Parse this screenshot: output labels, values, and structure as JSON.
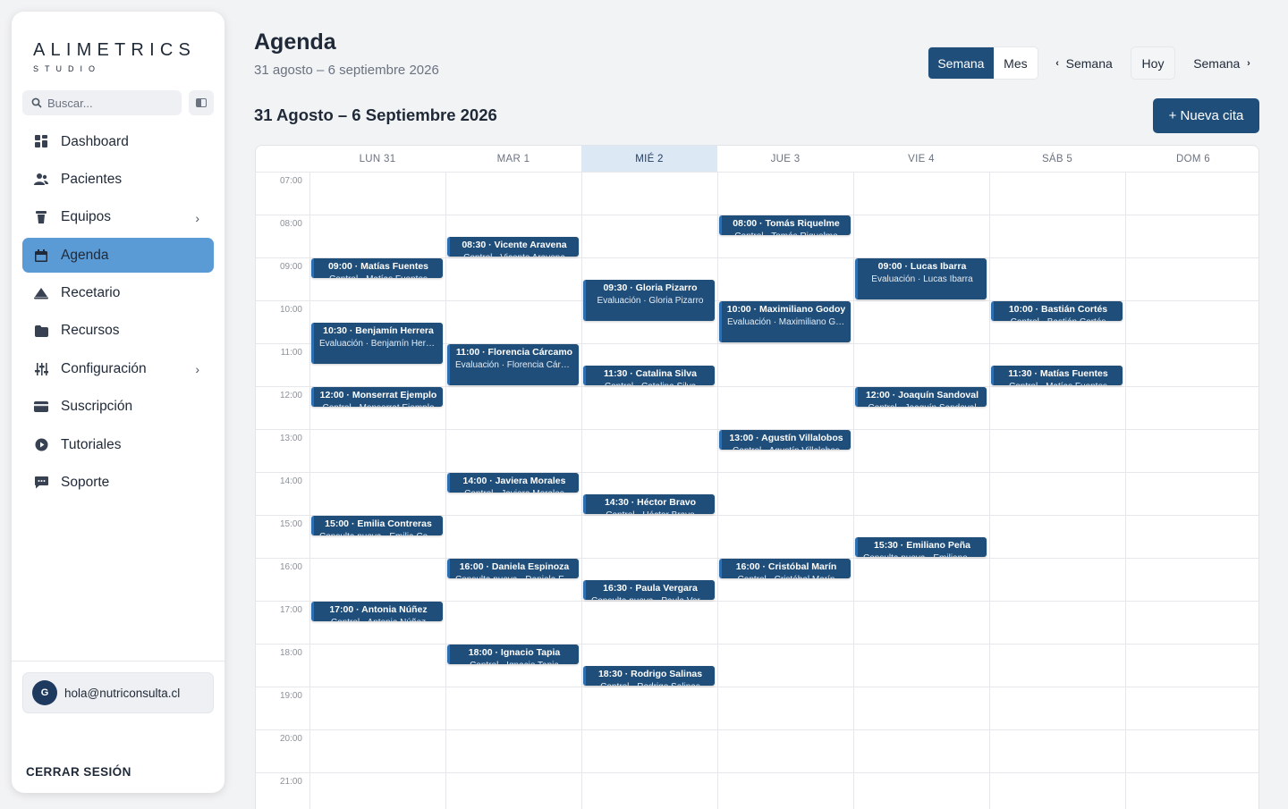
{
  "brand": {
    "name": "ALIMETRICS",
    "sub": "STUDIO"
  },
  "search": {
    "placeholder": "Buscar..."
  },
  "sidebar": {
    "items": [
      {
        "id": "dashboard",
        "label": "Dashboard",
        "icon": "dashboard-icon",
        "chevron": false,
        "active": false
      },
      {
        "id": "pacientes",
        "label": "Pacientes",
        "icon": "users-icon",
        "chevron": false,
        "active": false
      },
      {
        "id": "equipos",
        "label": "Equipos",
        "icon": "flask-icon",
        "chevron": true,
        "active": false
      },
      {
        "id": "agenda",
        "label": "Agenda",
        "icon": "calendar-icon",
        "chevron": false,
        "active": true
      },
      {
        "id": "recetario",
        "label": "Recetario",
        "icon": "recipe-icon",
        "chevron": false,
        "active": false
      },
      {
        "id": "recursos",
        "label": "Recursos",
        "icon": "folder-icon",
        "chevron": false,
        "active": false
      },
      {
        "id": "configuracion",
        "label": "Configuración",
        "icon": "sliders-icon",
        "chevron": true,
        "active": false
      },
      {
        "id": "suscripcion",
        "label": "Suscripción",
        "icon": "credit-card-icon",
        "chevron": false,
        "active": false
      },
      {
        "id": "tutoriales",
        "label": "Tutoriales",
        "icon": "play-icon",
        "chevron": false,
        "active": false
      },
      {
        "id": "soporte",
        "label": "Soporte",
        "icon": "chat-icon",
        "chevron": false,
        "active": false
      }
    ]
  },
  "user": {
    "initial": "G",
    "email": "hola@nutriconsulta.cl"
  },
  "logout_label": "CERRAR SESIÓN",
  "header": {
    "title": "Agenda",
    "subtitle": "31 agosto – 6 septiembre 2026",
    "view_week": "Semana",
    "view_month": "Mes",
    "prev_label": "Semana",
    "today_label": "Hoy",
    "next_label": "Semana"
  },
  "range_title": "31 Agosto – 6 Septiembre 2026",
  "new_button": "+ Nueva cita",
  "days": [
    "LUN 31",
    "MAR 1",
    "MIÉ 2",
    "JUE 3",
    "VIE 4",
    "SÁB 5",
    "DOM 6"
  ],
  "today_index": 2,
  "hours": [
    "07:00",
    "08:00",
    "09:00",
    "10:00",
    "11:00",
    "12:00",
    "13:00",
    "14:00",
    "15:00",
    "16:00",
    "17:00",
    "18:00",
    "19:00",
    "20:00",
    "21:00"
  ],
  "events": [
    {
      "day": 0,
      "start": "09:00",
      "hours": 0.5,
      "title": "09:00 · Matías Fuentes",
      "sub": "Control · Matías Fuentes"
    },
    {
      "day": 0,
      "start": "10:30",
      "hours": 1,
      "title": "10:30 · Benjamín Herrera",
      "sub": "Evaluación · Benjamín Herrera"
    },
    {
      "day": 0,
      "start": "12:00",
      "hours": 0.5,
      "title": "12:00 · Monserrat Ejemplo",
      "sub": "Control · Monserrat Ejemplo"
    },
    {
      "day": 0,
      "start": "15:00",
      "hours": 0.5,
      "title": "15:00 · Emilia Contreras",
      "sub": "Consulta nueva · Emilia Contreras"
    },
    {
      "day": 0,
      "start": "17:00",
      "hours": 0.5,
      "title": "17:00 · Antonia Núñez",
      "sub": "Control · Antonia Núñez"
    },
    {
      "day": 1,
      "start": "08:30",
      "hours": 0.5,
      "title": "08:30 · Vicente Aravena",
      "sub": "Control · Vicente Aravena"
    },
    {
      "day": 1,
      "start": "11:00",
      "hours": 1,
      "title": "11:00 · Florencia Cárcamo",
      "sub": "Evaluación · Florencia Cárcamo"
    },
    {
      "day": 1,
      "start": "14:00",
      "hours": 0.5,
      "title": "14:00 · Javiera Morales",
      "sub": "Control · Javiera Morales"
    },
    {
      "day": 1,
      "start": "16:00",
      "hours": 0.5,
      "title": "16:00 · Daniela Espinoza",
      "sub": "Consulta nueva · Daniela Espinoza"
    },
    {
      "day": 1,
      "start": "18:00",
      "hours": 0.5,
      "title": "18:00 · Ignacio Tapia",
      "sub": "Control · Ignacio Tapia"
    },
    {
      "day": 2,
      "start": "09:30",
      "hours": 1,
      "title": "09:30 · Gloria Pizarro",
      "sub": "Evaluación · Gloria Pizarro"
    },
    {
      "day": 2,
      "start": "11:30",
      "hours": 0.5,
      "title": "11:30 · Catalina Silva",
      "sub": "Control · Catalina Silva"
    },
    {
      "day": 2,
      "start": "14:30",
      "hours": 0.5,
      "title": "14:30 · Héctor Bravo",
      "sub": "Control · Héctor Bravo"
    },
    {
      "day": 2,
      "start": "16:30",
      "hours": 0.5,
      "title": "16:30 · Paula Vergara",
      "sub": "Consulta nueva · Paula Vergara"
    },
    {
      "day": 2,
      "start": "18:30",
      "hours": 0.5,
      "title": "18:30 · Rodrigo Salinas",
      "sub": "Control · Rodrigo Salinas"
    },
    {
      "day": 3,
      "start": "08:00",
      "hours": 0.5,
      "title": "08:00 · Tomás Riquelme",
      "sub": "Control · Tomás Riquelme"
    },
    {
      "day": 3,
      "start": "10:00",
      "hours": 1,
      "title": "10:00 · Maximiliano Godoy",
      "sub": "Evaluación · Maximiliano Godoy"
    },
    {
      "day": 3,
      "start": "13:00",
      "hours": 0.5,
      "title": "13:00 · Agustín Villalobos",
      "sub": "Control · Agustín Villalobos"
    },
    {
      "day": 3,
      "start": "16:00",
      "hours": 0.5,
      "title": "16:00 · Cristóbal Marín",
      "sub": "Control · Cristóbal Marín"
    },
    {
      "day": 4,
      "start": "09:00",
      "hours": 1,
      "title": "09:00 · Lucas Ibarra",
      "sub": "Evaluación · Lucas Ibarra"
    },
    {
      "day": 4,
      "start": "12:00",
      "hours": 0.5,
      "title": "12:00 · Joaquín Sandoval",
      "sub": "Control · Joaquín Sandoval"
    },
    {
      "day": 4,
      "start": "15:30",
      "hours": 0.5,
      "title": "15:30 · Emiliano Peña",
      "sub": "Consulta nueva · Emiliano Peña"
    },
    {
      "day": 5,
      "start": "10:00",
      "hours": 0.5,
      "title": "10:00 · Bastián Cortés",
      "sub": "Control · Bastián Cortés"
    },
    {
      "day": 5,
      "start": "11:30",
      "hours": 0.5,
      "title": "11:30 · Matías Fuentes",
      "sub": "Control · Matías Fuentes"
    }
  ],
  "colors": {
    "primary": "#1f4e7a",
    "active_nav": "#5b9bd5",
    "today_header": "#dde8f5",
    "event_accent": "#2d6fb0"
  }
}
